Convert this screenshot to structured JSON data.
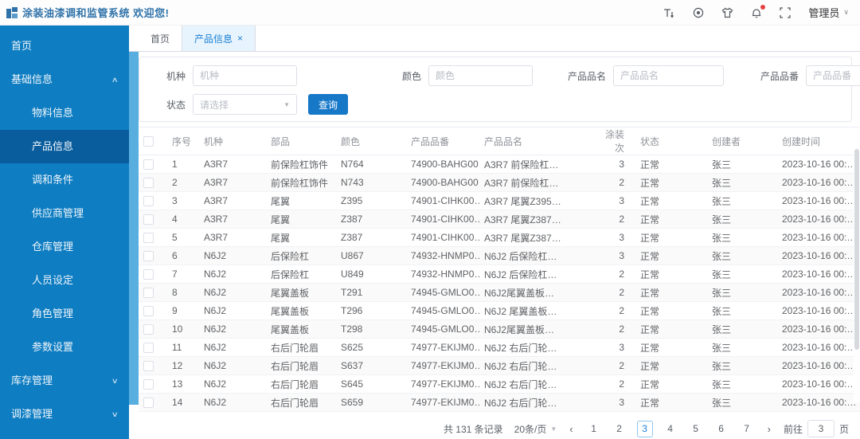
{
  "header": {
    "title": "涂装油漆调和监管系统 欢迎您!",
    "user_name": "管理员",
    "icons": [
      "font-size-icon",
      "help-circle-icon",
      "theme-shirt-icon",
      "notification-bell-icon",
      "fullscreen-icon"
    ]
  },
  "sidebar": {
    "items": [
      {
        "id": "home",
        "label": "首页",
        "type": "top"
      },
      {
        "id": "basic-info",
        "label": "基础信息",
        "type": "top",
        "chevron": "up"
      },
      {
        "id": "material-info",
        "label": "物料信息",
        "type": "sub"
      },
      {
        "id": "product-info",
        "label": "产品信息",
        "type": "sub",
        "active": true
      },
      {
        "id": "blend-condition",
        "label": "调和条件",
        "type": "sub"
      },
      {
        "id": "supplier-mgmt",
        "label": "供应商管理",
        "type": "sub"
      },
      {
        "id": "warehouse-mgmt",
        "label": "仓库管理",
        "type": "sub"
      },
      {
        "id": "personnel-setting",
        "label": "人员设定",
        "type": "sub"
      },
      {
        "id": "role-mgmt",
        "label": "角色管理",
        "type": "sub"
      },
      {
        "id": "param-setting",
        "label": "参数设置",
        "type": "sub"
      },
      {
        "id": "inventory-mgmt",
        "label": "库存管理",
        "type": "top",
        "chevron": "down"
      },
      {
        "id": "paint-mgmt",
        "label": "调漆管理",
        "type": "top",
        "chevron": "down"
      }
    ]
  },
  "tabs": [
    {
      "label": "首页",
      "active": false,
      "closable": false
    },
    {
      "label": "产品信息",
      "active": true,
      "closable": true
    }
  ],
  "filters": {
    "fields": [
      {
        "label": "机种",
        "placeholder": "机种"
      },
      {
        "label": "颜色",
        "placeholder": "颜色"
      },
      {
        "label": "产品品名",
        "placeholder": "产品品名"
      },
      {
        "label": "产品品番",
        "placeholder": "产品品番"
      },
      {
        "label": "状态",
        "placeholder": "请选择",
        "type": "select"
      }
    ],
    "search_label": "查询"
  },
  "table": {
    "columns": [
      "序号",
      "机种",
      "部品",
      "颜色",
      "产品品番",
      "产品品名",
      "涂装次",
      "状态",
      "创建者",
      "创建时间"
    ],
    "rows": [
      {
        "seq": "1",
        "model": "A3R7",
        "part": "前保险杠饰件",
        "color": "N764",
        "part_no": "74900-BAHG00…",
        "name": "A3R7 前保险杠…",
        "coats": "3",
        "status": "正常",
        "creator": "张三",
        "created": "2023-10-16 00:…"
      },
      {
        "seq": "2",
        "model": "A3R7",
        "part": "前保险杠饰件",
        "color": "N743",
        "part_no": "74900-BAHG00…",
        "name": "A3R7 前保险杠…",
        "coats": "2",
        "status": "正常",
        "creator": "张三",
        "created": "2023-10-16 00:…"
      },
      {
        "seq": "3",
        "model": "A3R7",
        "part": "尾翼",
        "color": "Z395",
        "part_no": "74901-CIHK00…",
        "name": "A3R7 尾翼Z395…",
        "coats": "3",
        "status": "正常",
        "creator": "张三",
        "created": "2023-10-16 00:…"
      },
      {
        "seq": "4",
        "model": "A3R7",
        "part": "尾翼",
        "color": "Z387",
        "part_no": "74901-CIHK00…",
        "name": "A3R7 尾翼Z387…",
        "coats": "2",
        "status": "正常",
        "creator": "张三",
        "created": "2023-10-16 00:…"
      },
      {
        "seq": "5",
        "model": "A3R7",
        "part": "尾翼",
        "color": "Z387",
        "part_no": "74901-CIHK00…",
        "name": "A3R7 尾翼Z387…",
        "coats": "3",
        "status": "正常",
        "creator": "张三",
        "created": "2023-10-16 00:…"
      },
      {
        "seq": "6",
        "model": "N6J2",
        "part": "后保险杠",
        "color": "U867",
        "part_no": "74932-HNMP0…",
        "name": "N6J2 后保险杠…",
        "coats": "3",
        "status": "正常",
        "creator": "张三",
        "created": "2023-10-16 00:…"
      },
      {
        "seq": "7",
        "model": "N6J2",
        "part": "后保险杠",
        "color": "U849",
        "part_no": "74932-HNMP0…",
        "name": "N6J2 后保险杠…",
        "coats": "2",
        "status": "正常",
        "creator": "张三",
        "created": "2023-10-16 00:…"
      },
      {
        "seq": "8",
        "model": "N6J2",
        "part": "尾翼盖板",
        "color": "T291",
        "part_no": "74945-GMLO0…",
        "name": "N6J2尾翼盖板…",
        "coats": "2",
        "status": "正常",
        "creator": "张三",
        "created": "2023-10-16 00:…"
      },
      {
        "seq": "9",
        "model": "N6J2",
        "part": "尾翼盖板",
        "color": "T296",
        "part_no": "74945-GMLO0…",
        "name": "N6J2 尾翼盖板…",
        "coats": "2",
        "status": "正常",
        "creator": "张三",
        "created": "2023-10-16 00:…"
      },
      {
        "seq": "10",
        "model": "N6J2",
        "part": "尾翼盖板",
        "color": "T298",
        "part_no": "74945-GMLO0…",
        "name": "N6J2尾翼盖板…",
        "coats": "2",
        "status": "正常",
        "creator": "张三",
        "created": "2023-10-16 00:…"
      },
      {
        "seq": "11",
        "model": "N6J2",
        "part": "右后门轮眉",
        "color": "S625",
        "part_no": "74977-EKIJM0…",
        "name": "N6J2 右后门轮…",
        "coats": "3",
        "status": "正常",
        "creator": "张三",
        "created": "2023-10-16 00:…"
      },
      {
        "seq": "12",
        "model": "N6J2",
        "part": "右后门轮眉",
        "color": "S637",
        "part_no": "74977-EKIJM0…",
        "name": "N6J2 右后门轮…",
        "coats": "2",
        "status": "正常",
        "creator": "张三",
        "created": "2023-10-16 00:…"
      },
      {
        "seq": "13",
        "model": "N6J2",
        "part": "右后门轮眉",
        "color": "S645",
        "part_no": "74977-EKIJM0…",
        "name": "N6J2 右后门轮…",
        "coats": "2",
        "status": "正常",
        "creator": "张三",
        "created": "2023-10-16 00:…"
      },
      {
        "seq": "14",
        "model": "N6J2",
        "part": "右后门轮眉",
        "color": "S659",
        "part_no": "74977-EKIJM0…",
        "name": "N6J2 右后门轮…",
        "coats": "3",
        "status": "正常",
        "creator": "张三",
        "created": "2023-10-16 00:…"
      }
    ]
  },
  "pagination": {
    "total_text": "共 131 条记录",
    "page_size": "20条/页",
    "pages": [
      "1",
      "2",
      "3",
      "4",
      "5",
      "6",
      "7"
    ],
    "current": "3",
    "goto_label": "前往",
    "goto_value": "3",
    "goto_suffix": "页"
  },
  "colors": {
    "sidebar": "#0e7dc2",
    "sidebar_active": "#0a5d9d",
    "accent": "#1778c8",
    "active_tab_bg": "#e7f4fd",
    "gutter": "#58aede",
    "notification_dot": "#e64242"
  }
}
